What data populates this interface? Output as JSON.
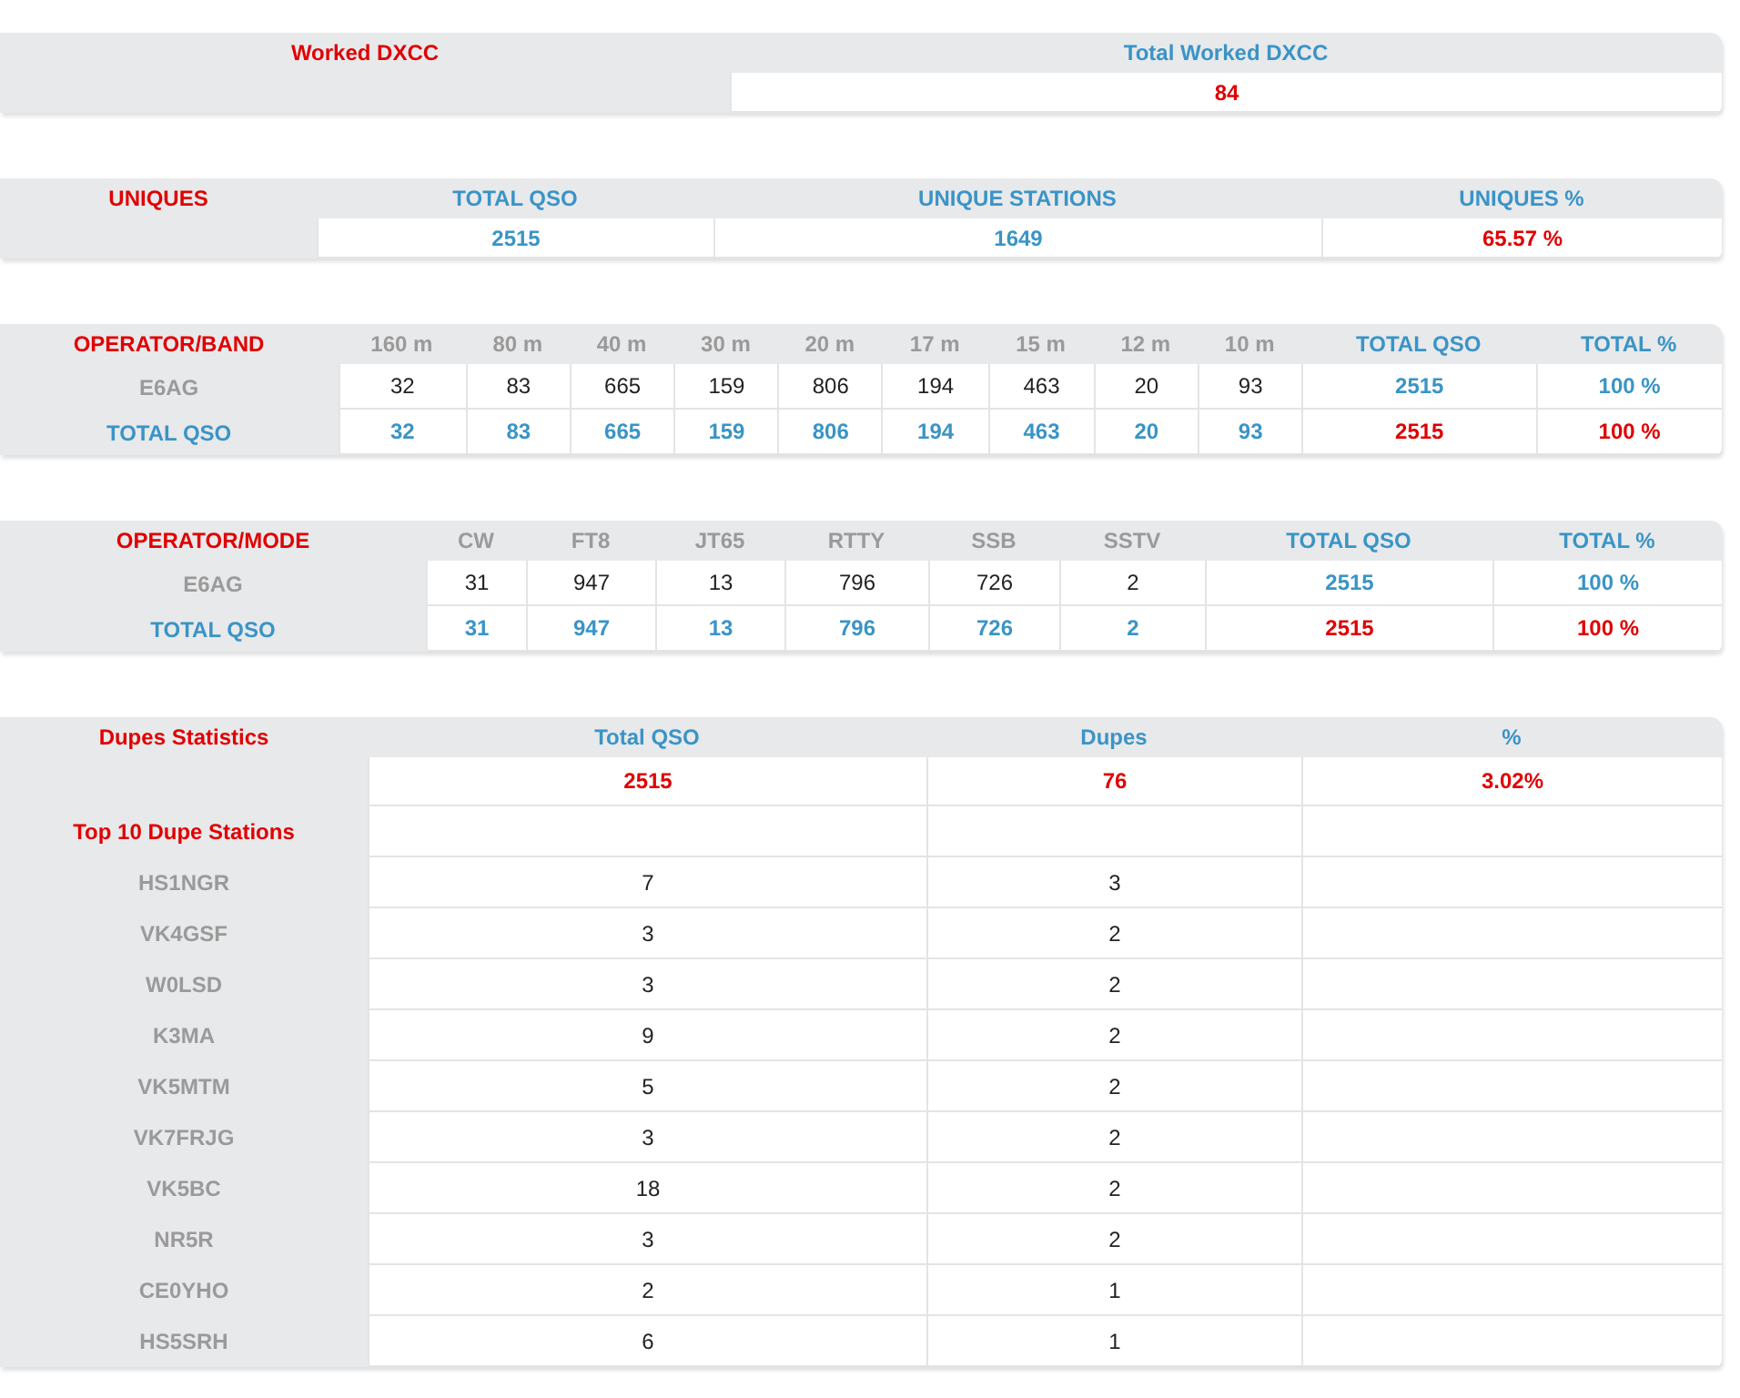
{
  "tables": [
    {
      "columns": [
        {
          "text": "Worked DXCC",
          "kind": "red"
        },
        {
          "text": "Total Worked DXCC",
          "kind": "blue"
        }
      ],
      "rows": [
        [
          {
            "kind": "blank"
          },
          {
            "text": "84",
            "kind": "red"
          }
        ]
      ]
    },
    {
      "columns": [
        {
          "text": "UNIQUES",
          "kind": "red"
        },
        {
          "text": "TOTAL QSO",
          "kind": "blue"
        },
        {
          "text": "UNIQUE STATIONS",
          "kind": "blue"
        },
        {
          "text": "UNIQUES %",
          "kind": "blue"
        }
      ],
      "rows": [
        [
          {
            "kind": "blank"
          },
          {
            "text": "2515",
            "kind": "blue"
          },
          {
            "text": "1649",
            "kind": "blue"
          },
          {
            "text": "65.57 %",
            "kind": "red"
          }
        ]
      ]
    },
    {
      "columns": [
        {
          "text": "OPERATOR/BAND",
          "kind": "red"
        },
        {
          "text": "160 m",
          "kind": "grey"
        },
        {
          "text": "80 m",
          "kind": "grey"
        },
        {
          "text": "40 m",
          "kind": "grey"
        },
        {
          "text": "30 m",
          "kind": "grey"
        },
        {
          "text": "20 m",
          "kind": "grey"
        },
        {
          "text": "17 m",
          "kind": "grey"
        },
        {
          "text": "15 m",
          "kind": "grey"
        },
        {
          "text": "12 m",
          "kind": "grey"
        },
        {
          "text": "10 m",
          "kind": "grey"
        },
        {
          "text": "TOTAL QSO",
          "kind": "blue"
        },
        {
          "text": "TOTAL %",
          "kind": "blue"
        }
      ],
      "rows": [
        [
          {
            "text": "E6AG",
            "kind": "grey"
          },
          {
            "text": "32",
            "kind": "plain"
          },
          {
            "text": "83",
            "kind": "plain"
          },
          {
            "text": "665",
            "kind": "plain"
          },
          {
            "text": "159",
            "kind": "plain"
          },
          {
            "text": "806",
            "kind": "plain"
          },
          {
            "text": "194",
            "kind": "plain"
          },
          {
            "text": "463",
            "kind": "plain"
          },
          {
            "text": "20",
            "kind": "plain"
          },
          {
            "text": "93",
            "kind": "plain"
          },
          {
            "text": "2515",
            "kind": "blue"
          },
          {
            "text": "100 %",
            "kind": "blue"
          }
        ],
        [
          {
            "text": "TOTAL QSO",
            "kind": "blue"
          },
          {
            "text": "32",
            "kind": "blue"
          },
          {
            "text": "83",
            "kind": "blue"
          },
          {
            "text": "665",
            "kind": "blue"
          },
          {
            "text": "159",
            "kind": "blue"
          },
          {
            "text": "806",
            "kind": "blue"
          },
          {
            "text": "194",
            "kind": "blue"
          },
          {
            "text": "463",
            "kind": "blue"
          },
          {
            "text": "20",
            "kind": "blue"
          },
          {
            "text": "93",
            "kind": "blue"
          },
          {
            "text": "2515",
            "kind": "red"
          },
          {
            "text": "100 %",
            "kind": "red"
          }
        ]
      ]
    },
    {
      "columns": [
        {
          "text": "OPERATOR/MODE",
          "kind": "red"
        },
        {
          "text": "CW",
          "kind": "grey"
        },
        {
          "text": "FT8",
          "kind": "grey"
        },
        {
          "text": "JT65",
          "kind": "grey"
        },
        {
          "text": "RTTY",
          "kind": "grey"
        },
        {
          "text": "SSB",
          "kind": "grey"
        },
        {
          "text": "SSTV",
          "kind": "grey"
        },
        {
          "text": "TOTAL QSO",
          "kind": "blue"
        },
        {
          "text": "TOTAL %",
          "kind": "blue"
        }
      ],
      "rows": [
        [
          {
            "text": "E6AG",
            "kind": "grey"
          },
          {
            "text": "31",
            "kind": "plain"
          },
          {
            "text": "947",
            "kind": "plain"
          },
          {
            "text": "13",
            "kind": "plain"
          },
          {
            "text": "796",
            "kind": "plain"
          },
          {
            "text": "726",
            "kind": "plain"
          },
          {
            "text": "2",
            "kind": "plain"
          },
          {
            "text": "2515",
            "kind": "blue"
          },
          {
            "text": "100 %",
            "kind": "blue"
          }
        ],
        [
          {
            "text": "TOTAL QSO",
            "kind": "blue"
          },
          {
            "text": "31",
            "kind": "blue"
          },
          {
            "text": "947",
            "kind": "blue"
          },
          {
            "text": "13",
            "kind": "blue"
          },
          {
            "text": "796",
            "kind": "blue"
          },
          {
            "text": "726",
            "kind": "blue"
          },
          {
            "text": "2",
            "kind": "blue"
          },
          {
            "text": "2515",
            "kind": "red"
          },
          {
            "text": "100 %",
            "kind": "red"
          }
        ]
      ]
    },
    {
      "columns": [
        {
          "text": "Dupes Statistics",
          "kind": "red"
        },
        {
          "text": "Total QSO",
          "kind": "blue"
        },
        {
          "text": "Dupes",
          "kind": "blue"
        },
        {
          "text": "%",
          "kind": "blue"
        }
      ],
      "rows": [
        [
          {
            "kind": "blank"
          },
          {
            "text": "2515",
            "kind": "red"
          },
          {
            "text": "76",
            "kind": "red"
          },
          {
            "text": "3.02%",
            "kind": "red"
          }
        ],
        [
          {
            "text": "Top 10 Dupe Stations",
            "kind": "red"
          },
          {
            "kind": "blank"
          },
          {
            "kind": "blank"
          },
          {
            "kind": "blank"
          }
        ],
        [
          {
            "text": "HS1NGR",
            "kind": "grey"
          },
          {
            "text": "7",
            "kind": "plain"
          },
          {
            "text": "3",
            "kind": "plain"
          },
          {
            "kind": "blank"
          }
        ],
        [
          {
            "text": "VK4GSF",
            "kind": "grey"
          },
          {
            "text": "3",
            "kind": "plain"
          },
          {
            "text": "2",
            "kind": "plain"
          },
          {
            "kind": "blank"
          }
        ],
        [
          {
            "text": "W0LSD",
            "kind": "grey"
          },
          {
            "text": "3",
            "kind": "plain"
          },
          {
            "text": "2",
            "kind": "plain"
          },
          {
            "kind": "blank"
          }
        ],
        [
          {
            "text": "K3MA",
            "kind": "grey"
          },
          {
            "text": "9",
            "kind": "plain"
          },
          {
            "text": "2",
            "kind": "plain"
          },
          {
            "kind": "blank"
          }
        ],
        [
          {
            "text": "VK5MTM",
            "kind": "grey"
          },
          {
            "text": "5",
            "kind": "plain"
          },
          {
            "text": "2",
            "kind": "plain"
          },
          {
            "kind": "blank"
          }
        ],
        [
          {
            "text": "VK7FRJG",
            "kind": "grey"
          },
          {
            "text": "3",
            "kind": "plain"
          },
          {
            "text": "2",
            "kind": "plain"
          },
          {
            "kind": "blank"
          }
        ],
        [
          {
            "text": "VK5BC",
            "kind": "grey"
          },
          {
            "text": "18",
            "kind": "plain"
          },
          {
            "text": "2",
            "kind": "plain"
          },
          {
            "kind": "blank"
          }
        ],
        [
          {
            "text": "NR5R",
            "kind": "grey"
          },
          {
            "text": "3",
            "kind": "plain"
          },
          {
            "text": "2",
            "kind": "plain"
          },
          {
            "kind": "blank"
          }
        ],
        [
          {
            "text": "CE0YHO",
            "kind": "grey"
          },
          {
            "text": "2",
            "kind": "plain"
          },
          {
            "text": "1",
            "kind": "plain"
          },
          {
            "kind": "blank"
          }
        ],
        [
          {
            "text": "HS5SRH",
            "kind": "grey"
          },
          {
            "text": "6",
            "kind": "plain"
          },
          {
            "text": "1",
            "kind": "plain"
          },
          {
            "kind": "blank"
          }
        ]
      ]
    }
  ]
}
